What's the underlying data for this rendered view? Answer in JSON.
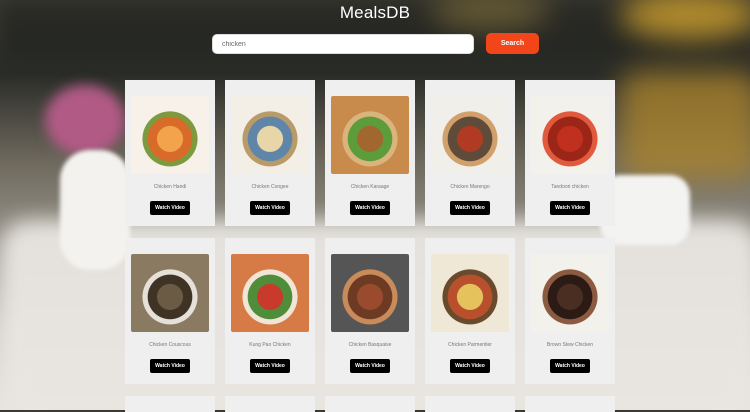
{
  "app": {
    "title": "MealsDB"
  },
  "search": {
    "value": "chicken",
    "placeholder": "",
    "button_label": "Search"
  },
  "meals": [
    {
      "name": "Chicken Handi",
      "button": "Watch Video",
      "image": "meal-photo"
    },
    {
      "name": "Chicken Congee",
      "button": "Watch Video",
      "image": "meal-photo"
    },
    {
      "name": "Chicken Karaage",
      "button": "Watch Video",
      "image": "meal-photo"
    },
    {
      "name": "Chicken Marengo",
      "button": "Watch Video",
      "image": "meal-photo"
    },
    {
      "name": "Tandoori chicken",
      "button": "Watch Video",
      "image": "meal-photo"
    },
    {
      "name": "Chicken Couscous",
      "button": "Watch Video",
      "image": "meal-photo"
    },
    {
      "name": "Kung Pao Chicken",
      "button": "Watch Video",
      "image": "meal-photo"
    },
    {
      "name": "Chicken Basquaise",
      "button": "Watch Video",
      "image": "meal-photo"
    },
    {
      "name": "Chicken Parmentier",
      "button": "Watch Video",
      "image": "meal-photo"
    },
    {
      "name": "Brown Stew Chicken",
      "button": "Watch Video",
      "image": "meal-photo"
    }
  ],
  "colors": {
    "search_button": "#f2461a",
    "watch_button": "#000000",
    "card_bg": "#efefef"
  }
}
